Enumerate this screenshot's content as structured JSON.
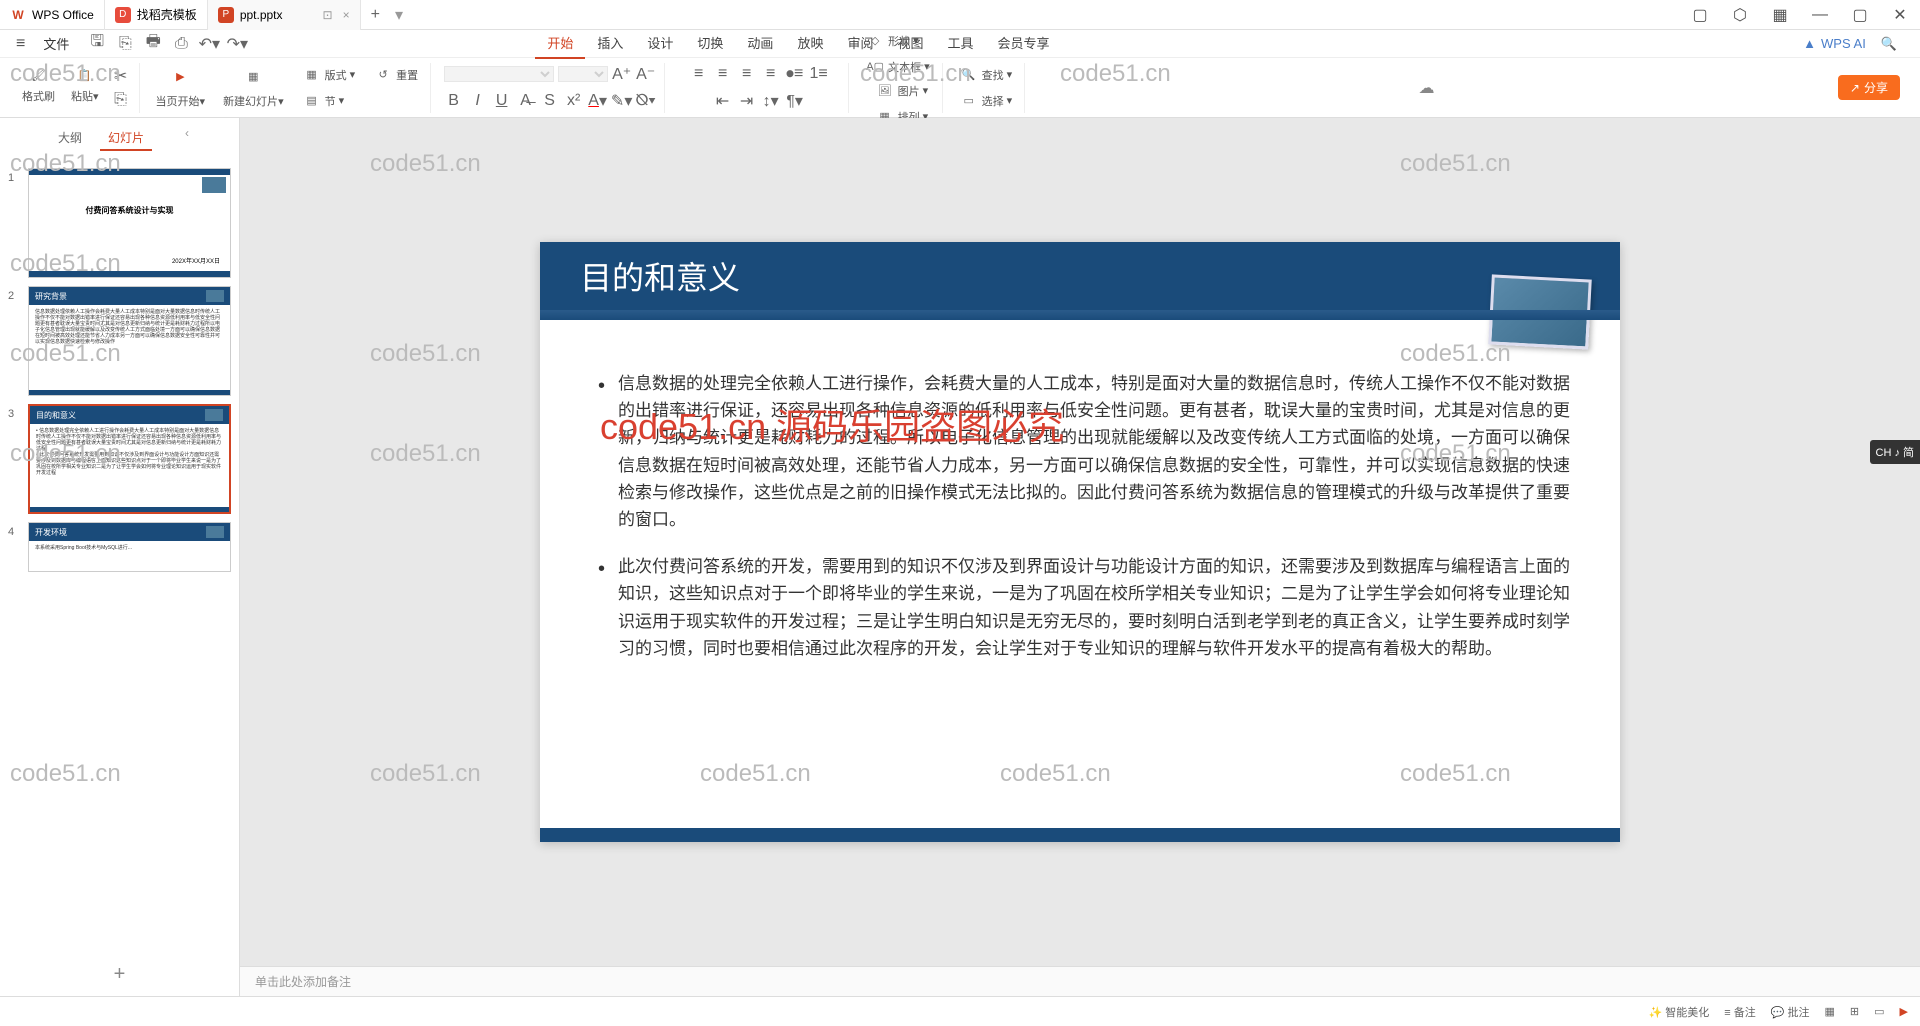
{
  "tabs": [
    {
      "icon": "W",
      "label": "WPS Office",
      "iconColor": "#d14424"
    },
    {
      "icon": "D",
      "label": "找稻壳模板",
      "iconColor": "#e74c3c"
    },
    {
      "icon": "P",
      "label": "ppt.pptx",
      "iconColor": "#d14424",
      "active": true
    }
  ],
  "app": {
    "file_label": "文件"
  },
  "menu": {
    "items": [
      "开始",
      "插入",
      "设计",
      "切换",
      "动画",
      "放映",
      "审阅",
      "视图",
      "工具",
      "会员专享"
    ],
    "active": 0,
    "wps_ai": "WPS AI"
  },
  "ribbon": {
    "format_painter": "格式刷",
    "paste": "粘贴",
    "from_current": "当页开始",
    "new_slide": "新建幻灯片",
    "format": "版式",
    "section": "节",
    "reset": "重置",
    "shape": "形状",
    "image": "图片",
    "textbox": "文本框",
    "arrange": "排列",
    "find": "查找",
    "select": "选择"
  },
  "share_label": "分享",
  "thumb_panel": {
    "outline": "大纲",
    "slides": "幻灯片"
  },
  "slides": {
    "1": {
      "title": "付费问答系统设计与实现",
      "date": "202X年XX月XX日"
    },
    "2": {
      "title": "研究背景"
    },
    "3": {
      "title": "目的和意义"
    },
    "4": {
      "title": "开发环境",
      "line": "本系统采用Spring Boot技术与MySQL进行..."
    }
  },
  "current_slide": {
    "title": "目的和意义",
    "bullets": [
      "信息数据的处理完全依赖人工进行操作，会耗费大量的人工成本，特别是面对大量的数据信息时，传统人工操作不仅不能对数据的出错率进行保证，还容易出现各种信息资源的低利用率与低安全性问题。更有甚者，耽误大量的宝贵时间，尤其是对信息的更新，归纳与统计更是耗财耗力的过程。所以电子化信息管理的出现就能缓解以及改变传统人工方式面临的处境，一方面可以确保信息数据在短时间被高效处理，还能节省人力成本，另一方面可以确保信息数据的安全性，可靠性，并可以实现信息数据的快速检索与修改操作，这些优点是之前的旧操作模式无法比拟的。因此付费问答系统为数据信息的管理模式的升级与改革提供了重要的窗口。",
      "此次付费问答系统的开发，需要用到的知识不仅涉及到界面设计与功能设计方面的知识，还需要涉及到数据库与编程语言上面的知识，这些知识点对于一个即将毕业的学生来说，一是为了巩固在校所学相关专业知识；二是为了让学生学会如何将专业理论知识运用于现实软件的开发过程；三是让学生明白知识是无穷无尽的，要时刻明白活到老学到老的真正含义，让学生要养成时刻学习的习惯，同时也要相信通过此次程序的开发，会让学生对于专业知识的理解与软件开发水平的提高有着极大的帮助。"
    ]
  },
  "notes_placeholder": "单击此处添加备注",
  "statusbar": {
    "smart_beauty": "智能美化",
    "notes": "备注",
    "comments": "批注"
  },
  "watermark_text": "code51.cn",
  "watermark_red": "code51.cn 源码乐园盗图必究",
  "ime": "CH ♪ 简"
}
